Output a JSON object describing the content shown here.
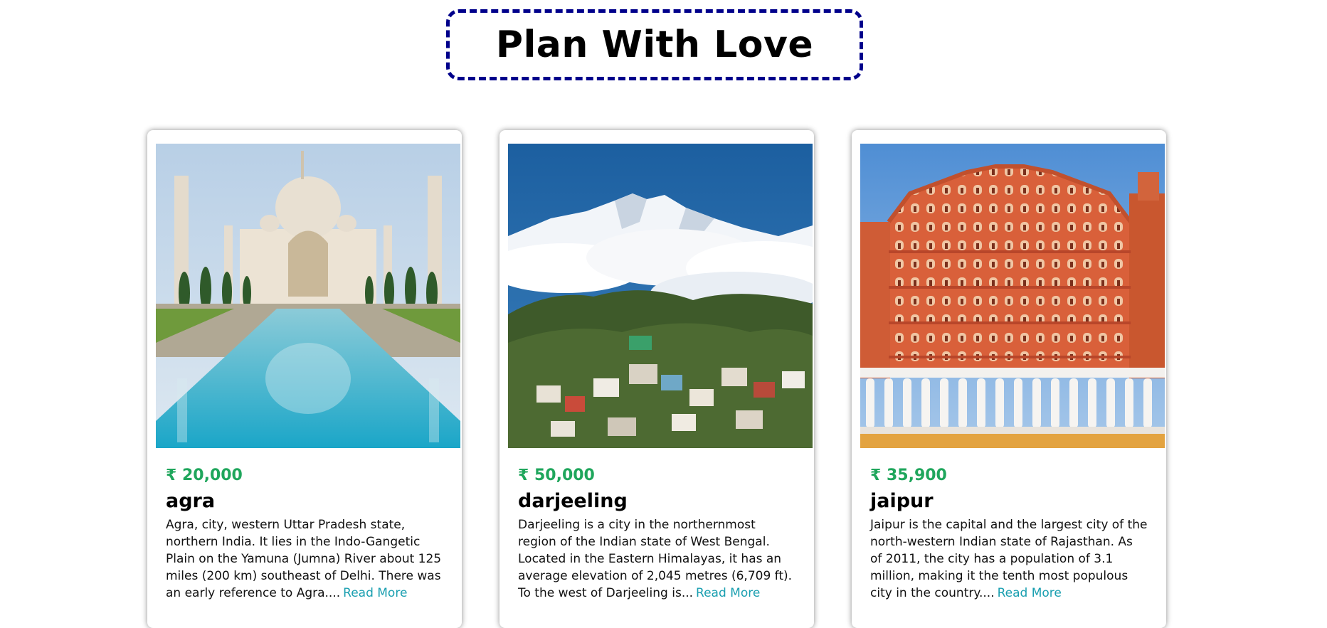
{
  "header": {
    "title": "Plan With Love"
  },
  "tours": [
    {
      "price": "₹ 20,000",
      "name": "agra",
      "description": "Agra, city, western Uttar Pradesh state, northern India. It lies in the Indo-Gangetic Plain on the Yamuna (Jumna) River about 125 miles (200 km) southeast of Delhi. There was an early reference to Agra....",
      "read_more_label": "Read More"
    },
    {
      "price": "₹ 50,000",
      "name": "darjeeling",
      "description": "Darjeeling is a city in the northernmost region of the Indian state of West Bengal. Located in the Eastern Himalayas, it has an average elevation of 2,045 metres (6,709 ft). To the west of Darjeeling is...",
      "read_more_label": "Read More"
    },
    {
      "price": "₹ 35,900",
      "name": "jaipur",
      "description": "Jaipur is the capital and the largest city of the north-western Indian state of Rajasthan. As of 2011, the city has a population of 3.1 million, making it the tenth most populous city in the country....",
      "read_more_label": "Read More"
    }
  ],
  "colors": {
    "title_border": "#00008b",
    "price": "#1fa65c",
    "read_more": "#1a9fb0"
  }
}
